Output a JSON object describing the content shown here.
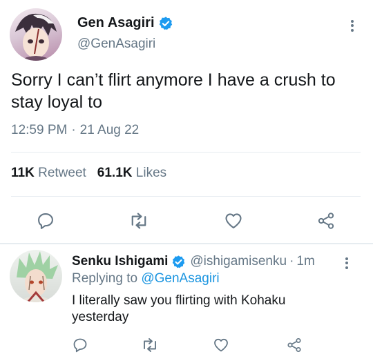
{
  "main_tweet": {
    "author_name": "Gen Asagiri",
    "handle": "@GenAsagiri",
    "text": "Sorry I can’t flirt anymore I have a crush to stay loyal to",
    "time": "12:59 PM",
    "separator": "·",
    "date": "21 Aug 22",
    "retweets_count": "11K",
    "retweets_label": "Retweet",
    "likes_count": "61.1K",
    "likes_label": "Likes",
    "verified": true
  },
  "reply": {
    "author_name": "Senku Ishigami",
    "handle": "@ishigamisenku",
    "separator": "·",
    "time_ago": "1m",
    "replying_prefix": "Replying to",
    "replying_to": "@GenAsagiri",
    "text": "I literally saw you flirting with Kohaku yesterday",
    "verified": true
  },
  "icons": {
    "more": "more-vertical-icon",
    "verified": "verified-badge-icon",
    "reply": "reply-icon",
    "retweet": "retweet-icon",
    "like": "heart-icon",
    "share": "share-icon"
  },
  "colors": {
    "verified": "#1d9bf0",
    "text": "#14171a",
    "muted": "#657786",
    "link": "#1b95e0",
    "divider": "#e6ecf0"
  }
}
